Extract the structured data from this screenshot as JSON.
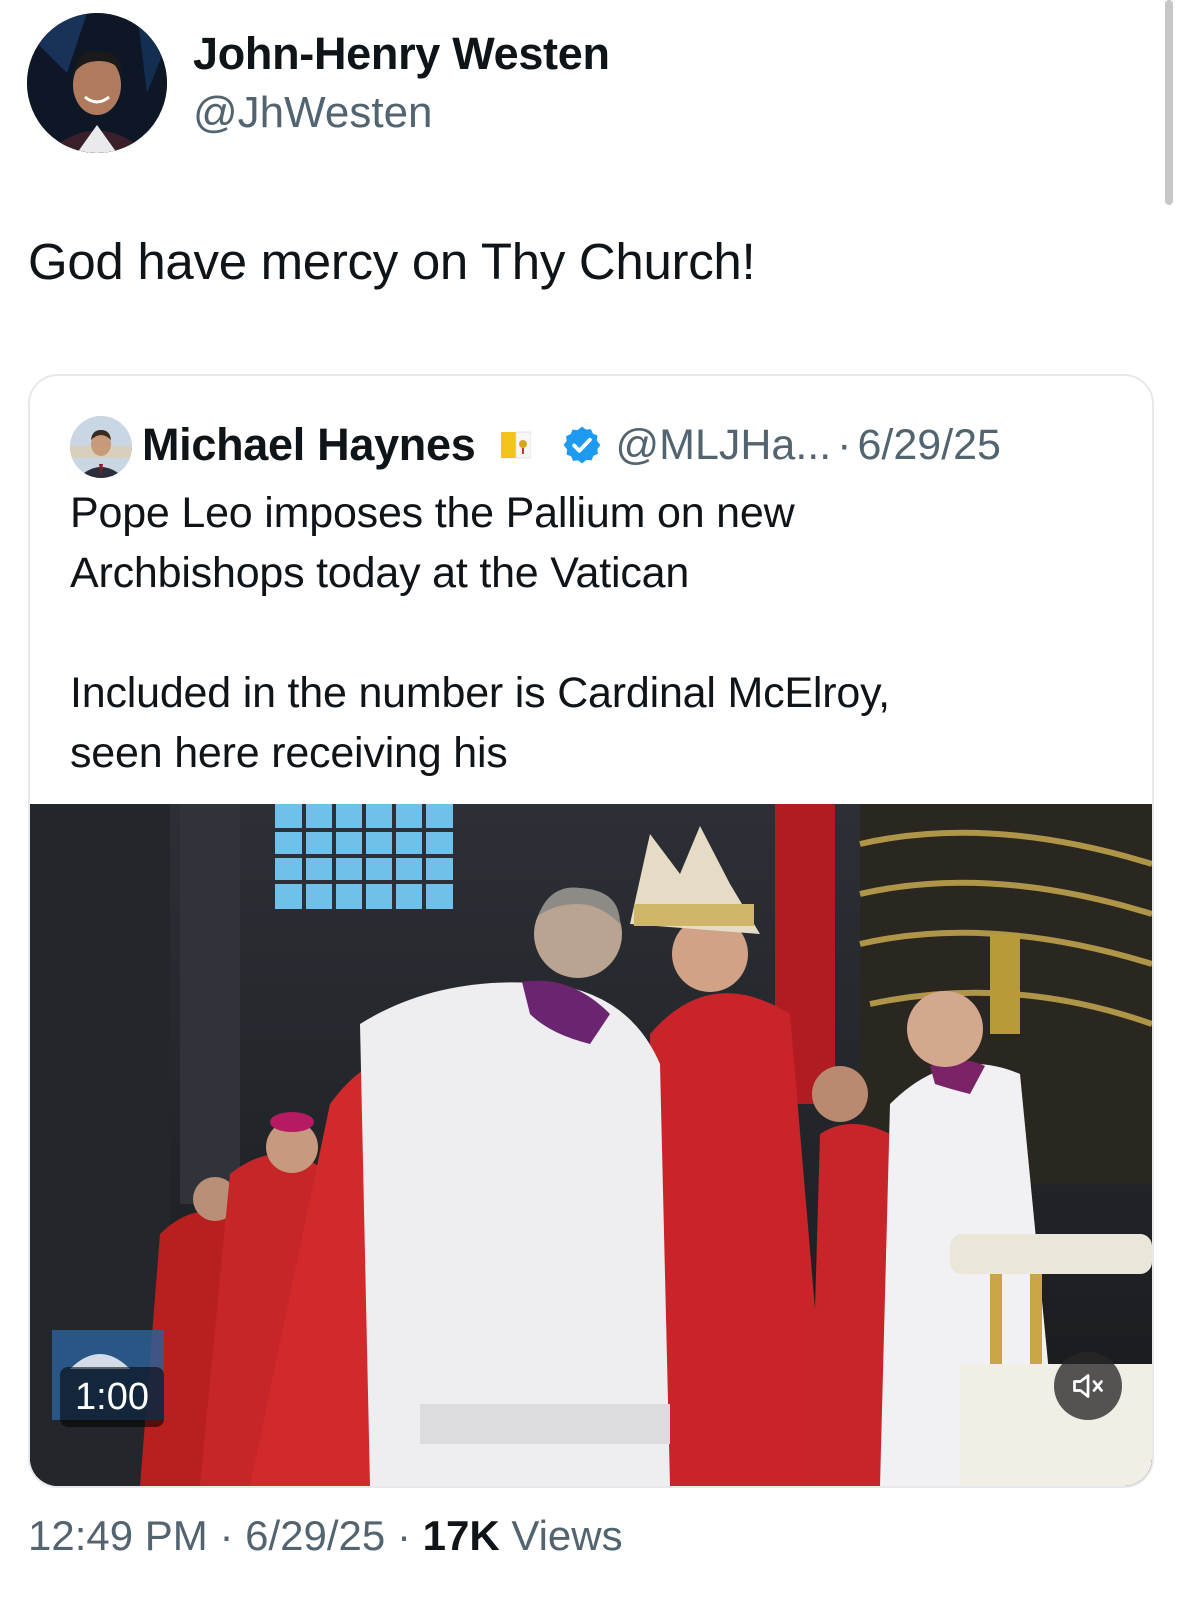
{
  "author": {
    "name": "John-Henry Westen",
    "handle": "@JhWesten"
  },
  "tweet": {
    "text": "God have mercy on Thy Church!"
  },
  "quoted": {
    "name": "Michael Haynes",
    "handle": "@MLJHa...",
    "separator": "·",
    "date": "6/29/25",
    "text": "Pope Leo imposes the Pallium on new\nArchbishops today at the Vatican\n\nIncluded in the number is Cardinal McElroy,\nseen here receiving his",
    "video": {
      "duration": "1:00",
      "muted": true
    }
  },
  "meta": {
    "time": "12:49 PM",
    "separator": "·",
    "date": "6/29/25",
    "views_count": "17K",
    "views_label": "Views"
  },
  "colors": {
    "secondary_text": "#536471",
    "verified_blue": "#1d9bf0",
    "border": "#e6e9ec"
  }
}
